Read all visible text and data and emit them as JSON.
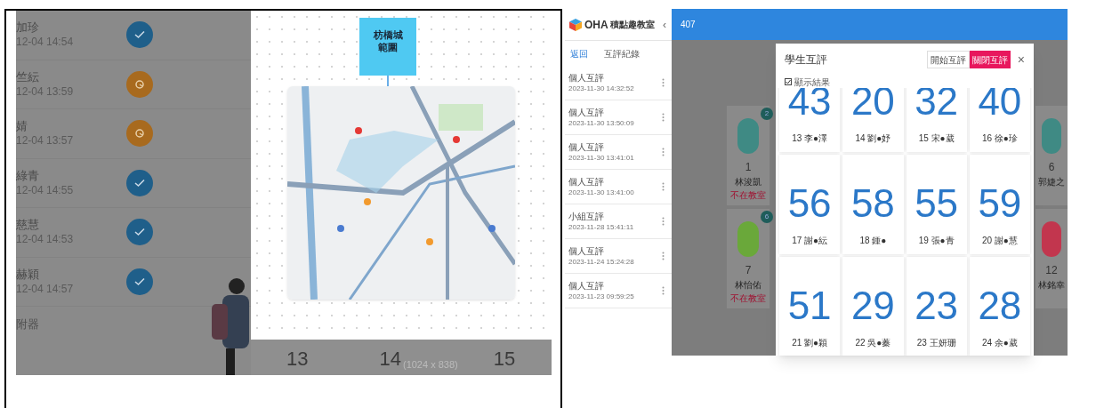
{
  "left_screen": {
    "rows": [
      {
        "name": "加珍",
        "time": "12-04 14:54",
        "kind": "done"
      },
      {
        "name": "竺紜",
        "time": "12-04 13:59",
        "kind": "pending"
      },
      {
        "name": "婧",
        "time": "12-04 13:57",
        "kind": "pending"
      },
      {
        "name": "綠青",
        "time": "12-04 14:55",
        "kind": "done"
      },
      {
        "name": "慈慧",
        "time": "12-04 14:53",
        "kind": "done"
      },
      {
        "name": "赫穎",
        "time": "12-04 14:57",
        "kind": "done"
      }
    ],
    "last_row": "附器",
    "sticky_note": "枋橋城範圍",
    "bottom_numbers": [
      "13",
      "14",
      "15"
    ],
    "image_size": "(1024 x 838)"
  },
  "right_screen": {
    "logo_mark": "OHA",
    "logo_text": "積點趣教室",
    "collapse": "‹",
    "back": "返回",
    "page_title": "互評紀錄",
    "records": [
      {
        "title": "個人互評",
        "time": "2023-11-30 14:32:52"
      },
      {
        "title": "個人互評",
        "time": "2023-11-30 13:50:09"
      },
      {
        "title": "個人互評",
        "time": "2023-11-30 13:41:01"
      },
      {
        "title": "個人互評",
        "time": "2023-11-30 13:41:00"
      },
      {
        "title": "小組互評",
        "time": "2023-11-28 15:41:11"
      },
      {
        "title": "個人互評",
        "time": "2023-11-24 15:24:28"
      },
      {
        "title": "個人互評",
        "time": "2023-11-23 09:59:25"
      }
    ],
    "class_name": "407",
    "left_cards": [
      {
        "badge": "2",
        "number": "1",
        "name": "林浚凱",
        "status": "不在教室",
        "color": "#3f8a84"
      },
      {
        "badge": "6",
        "number": "7",
        "name": "林怡佑",
        "status": "不在教室",
        "color": "#6aa83a"
      }
    ],
    "right_cards": [
      {
        "number": "6",
        "name": "郭婕之",
        "color": "#3f8a84"
      },
      {
        "number": "12",
        "name": "林銘幸",
        "color": "#c2364e"
      }
    ],
    "modal": {
      "title": "學生互評",
      "buttons": [
        {
          "label": "開始互評",
          "selected": false
        },
        {
          "label": "關閉互評",
          "selected": true
        }
      ],
      "close": "×",
      "show_results": {
        "label": "顯示結果",
        "checked": true
      },
      "scores": [
        {
          "score": "43",
          "name": "13 李●澤"
        },
        {
          "score": "20",
          "name": "14 劉●妤"
        },
        {
          "score": "32",
          "name": "15 宋●葳"
        },
        {
          "score": "40",
          "name": "16 徐●珍"
        },
        {
          "score": "56",
          "name": "17 謝●紜"
        },
        {
          "score": "58",
          "name": "18 鍾●"
        },
        {
          "score": "55",
          "name": "19 張●青"
        },
        {
          "score": "59",
          "name": "20 謝●慧"
        },
        {
          "score": "51",
          "name": "21 劉●穎"
        },
        {
          "score": "29",
          "name": "22 吳●蓁"
        },
        {
          "score": "23",
          "name": "23 王妍珊"
        },
        {
          "score": "28",
          "name": "24 余●葳"
        }
      ]
    }
  }
}
